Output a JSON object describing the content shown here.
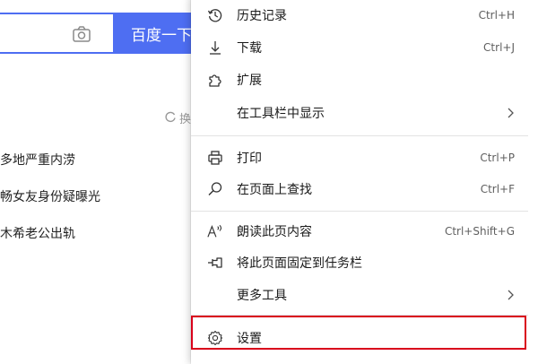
{
  "background": {
    "search_button_label": "百度一下",
    "refresh_label": "换一换",
    "news": [
      "多地严重内涝",
      "畅女友身份疑曝光",
      "木希老公出轨"
    ],
    "accent_color": "#4e6ef2"
  },
  "menu": {
    "items": [
      {
        "label": "历史记录",
        "shortcut": "Ctrl+H",
        "icon": "history-icon"
      },
      {
        "label": "下载",
        "shortcut": "Ctrl+J",
        "icon": "download-icon"
      },
      {
        "label": "扩展",
        "shortcut": "",
        "icon": "extensions-icon"
      },
      {
        "label": "在工具栏中显示",
        "shortcut": "",
        "icon": "",
        "submenu": true
      },
      {
        "label": "打印",
        "shortcut": "Ctrl+P",
        "icon": "print-icon"
      },
      {
        "label": "在页面上查找",
        "shortcut": "Ctrl+F",
        "icon": "search-icon"
      },
      {
        "label": "朗读此页内容",
        "shortcut": "Ctrl+Shift+G",
        "icon": "read-aloud-icon"
      },
      {
        "label": "将此页面固定到任务栏",
        "shortcut": "",
        "icon": "pin-icon"
      },
      {
        "label": "更多工具",
        "shortcut": "",
        "icon": "",
        "submenu": true
      },
      {
        "label": "设置",
        "shortcut": "",
        "icon": "settings-icon",
        "highlighted": true
      }
    ],
    "highlight_color": "#d9001b"
  }
}
